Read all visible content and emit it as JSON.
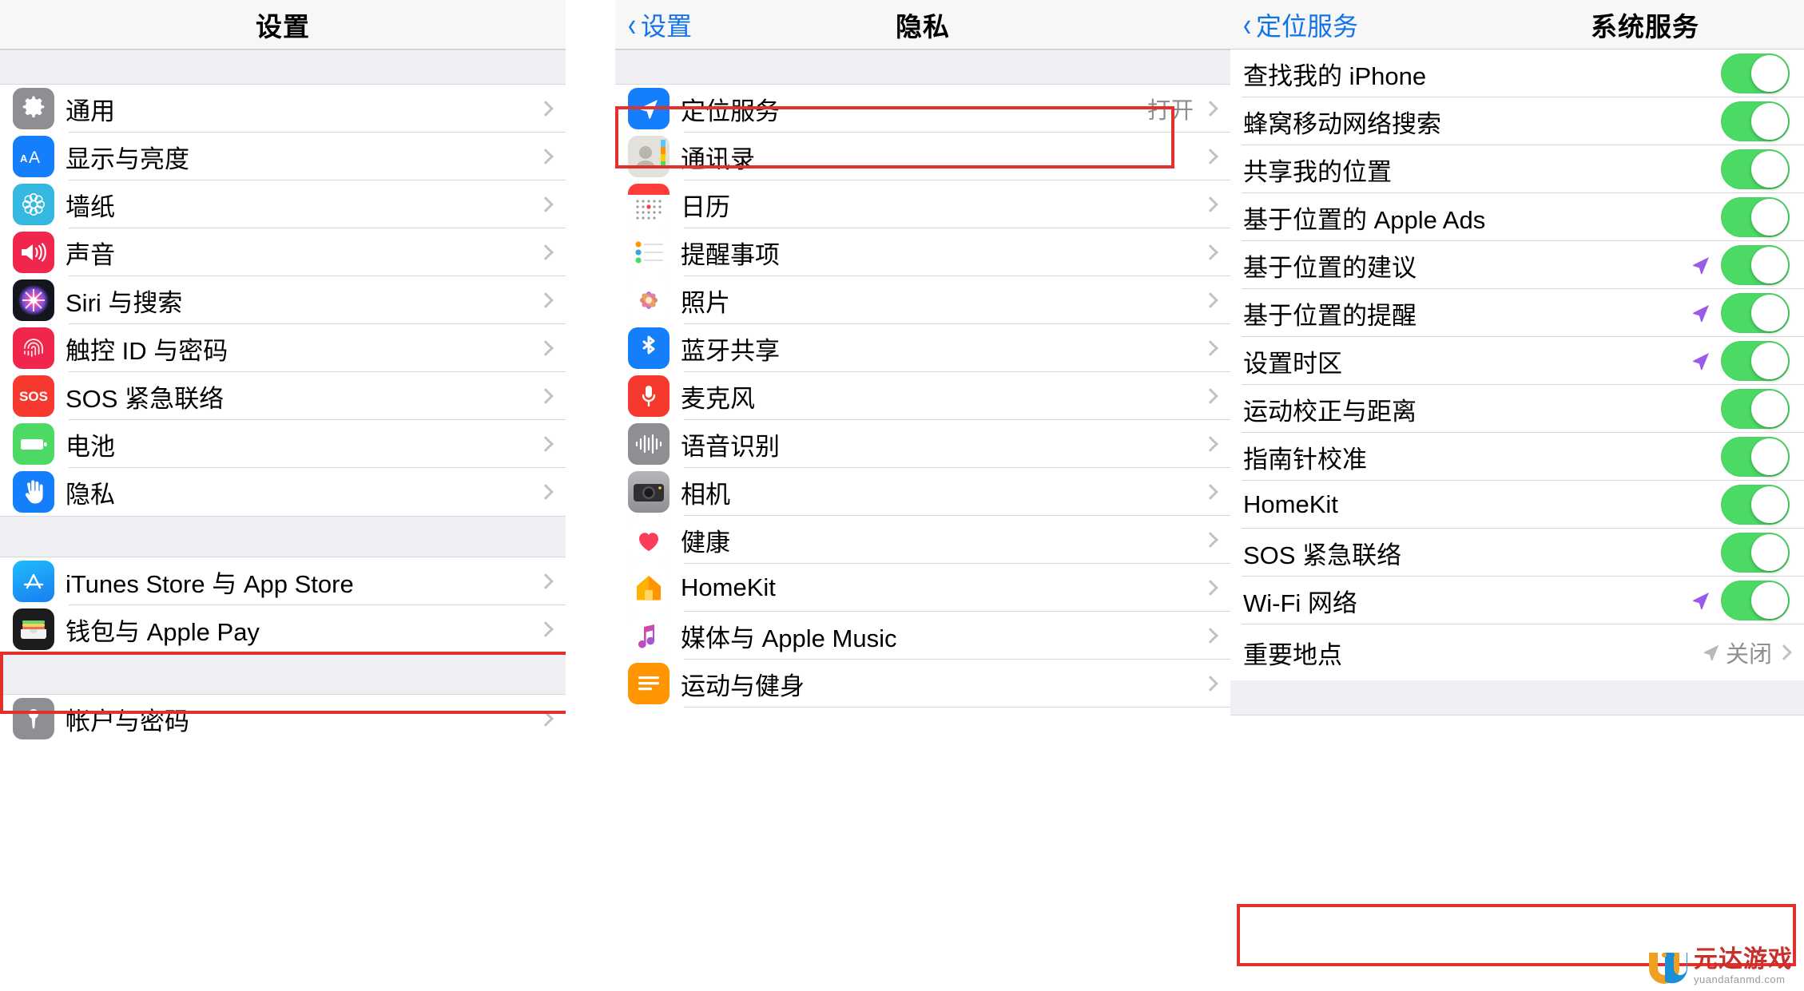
{
  "panels": {
    "left": {
      "title": "设置",
      "groups": [
        {
          "items": [
            {
              "label": "通用",
              "icon": "gear-icon"
            },
            {
              "label": "显示与亮度",
              "icon": "display-brightness-icon"
            },
            {
              "label": "墙纸",
              "icon": "wallpaper-icon"
            },
            {
              "label": "声音",
              "icon": "sound-icon"
            },
            {
              "label": "Siri 与搜索",
              "icon": "siri-icon"
            },
            {
              "label": "触控 ID 与密码",
              "icon": "touch-id-icon"
            },
            {
              "label": "SOS 紧急联络",
              "icon": "sos-icon"
            },
            {
              "label": "电池",
              "icon": "battery-icon"
            },
            {
              "label": "隐私",
              "icon": "privacy-hand-icon",
              "highlighted": true
            }
          ]
        },
        {
          "items": [
            {
              "label": "iTunes Store 与 App Store",
              "icon": "app-store-icon"
            },
            {
              "label": "钱包与 Apple Pay",
              "icon": "wallet-icon"
            }
          ]
        },
        {
          "items": [
            {
              "label": "帐户与密码",
              "icon": "accounts-passwords-icon"
            }
          ]
        }
      ]
    },
    "middle": {
      "back_label": "设置",
      "title": "隐私",
      "items": [
        {
          "label": "定位服务",
          "icon": "location-services-icon",
          "value": "打开",
          "highlighted": true
        },
        {
          "label": "通讯录",
          "icon": "contacts-icon"
        },
        {
          "label": "日历",
          "icon": "calendar-icon"
        },
        {
          "label": "提醒事项",
          "icon": "reminders-icon"
        },
        {
          "label": "照片",
          "icon": "photos-icon"
        },
        {
          "label": "蓝牙共享",
          "icon": "bluetooth-icon"
        },
        {
          "label": "麦克风",
          "icon": "microphone-icon"
        },
        {
          "label": "语音识别",
          "icon": "speech-recognition-icon"
        },
        {
          "label": "相机",
          "icon": "camera-icon"
        },
        {
          "label": "健康",
          "icon": "health-icon"
        },
        {
          "label": "HomeKit",
          "icon": "homekit-icon"
        },
        {
          "label": "媒体与 Apple Music",
          "icon": "apple-music-icon"
        },
        {
          "label": "运动与健身",
          "icon": "motion-fitness-icon"
        }
      ]
    },
    "right": {
      "back_label": "定位服务",
      "title": "系统服务",
      "items": [
        {
          "label": "查找我的 iPhone",
          "toggle": true,
          "arrow": false
        },
        {
          "label": "蜂窝移动网络搜索",
          "toggle": true,
          "arrow": false
        },
        {
          "label": "共享我的位置",
          "toggle": true,
          "arrow": false
        },
        {
          "label": "基于位置的 Apple Ads",
          "toggle": true,
          "arrow": false
        },
        {
          "label": "基于位置的建议",
          "toggle": true,
          "arrow": true
        },
        {
          "label": "基于位置的提醒",
          "toggle": true,
          "arrow": true
        },
        {
          "label": "设置时区",
          "toggle": true,
          "arrow": true
        },
        {
          "label": "运动校正与距离",
          "toggle": true,
          "arrow": false
        },
        {
          "label": "指南针校准",
          "toggle": true,
          "arrow": false
        },
        {
          "label": "HomeKit",
          "toggle": true,
          "arrow": false
        },
        {
          "label": "SOS 紧急联络",
          "toggle": true,
          "arrow": false
        },
        {
          "label": "Wi-Fi 网络",
          "toggle": true,
          "arrow": true
        },
        {
          "label": "重要地点",
          "toggle": false,
          "arrow": true,
          "value": "关闭",
          "chevron": true,
          "highlighted": true
        }
      ]
    }
  },
  "watermark": {
    "main": "元达游戏",
    "sub": "yuandafanmd.com"
  },
  "colors": {
    "highlight": "#e2312c",
    "accent_blue": "#1273e8",
    "toggle_on": "#4cd964",
    "location_purple": "#9b59e8",
    "muted": "#8e8e93"
  }
}
